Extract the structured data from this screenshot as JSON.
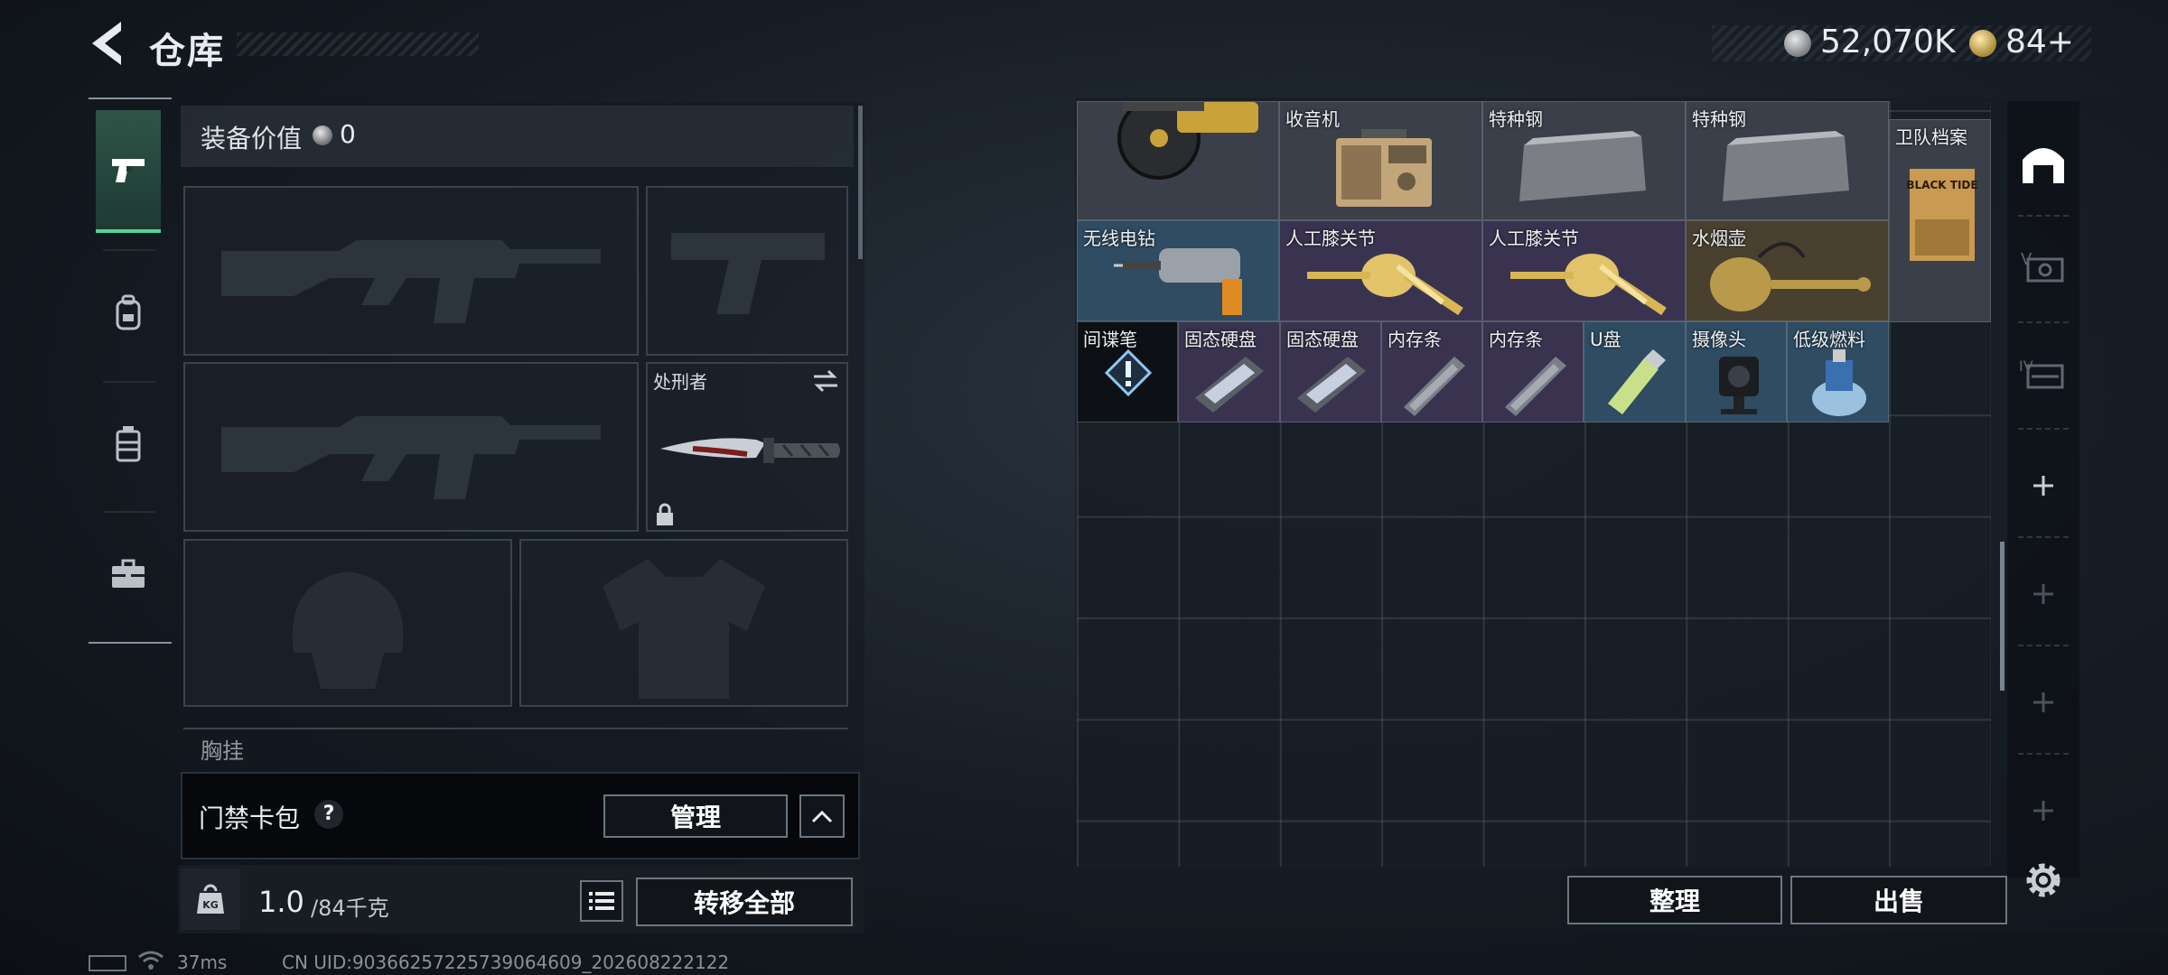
{
  "header": {
    "title": "仓库",
    "silver_currency": "52,070K",
    "gold_currency": "84+"
  },
  "left_tabs": [
    {
      "name": "pistol-icon",
      "active": true
    },
    {
      "name": "backpack-icon",
      "active": false
    },
    {
      "name": "vest-icon",
      "active": false
    },
    {
      "name": "briefcase-icon",
      "active": false
    }
  ],
  "equipment": {
    "value_label": "装备价值",
    "value": "0",
    "melee_slot_name": "处刑者",
    "chest_label": "胸挂",
    "chest_help": "?"
  },
  "card_pack": {
    "label": "门禁卡包",
    "help": "?",
    "manage_label": "管理"
  },
  "weight": {
    "current": "1.0",
    "max": "/84千克",
    "unit_icon_label": "KG",
    "transfer_all_label": "转移全部"
  },
  "status": {
    "ping": "37ms",
    "uid": "CN UID:903662572257390646​09_202608222122"
  },
  "storage_items": [
    {
      "id": "saw",
      "name": ""
    },
    {
      "id": "radio",
      "name": "收音机"
    },
    {
      "id": "steel1",
      "name": "特种钢"
    },
    {
      "id": "steel2",
      "name": "特种钢"
    },
    {
      "id": "guard-file",
      "name": "卫队档案",
      "art_text": "BLACK TIDE"
    },
    {
      "id": "drill",
      "name": "无线电钻"
    },
    {
      "id": "knee1",
      "name": "人工膝关节"
    },
    {
      "id": "knee2",
      "name": "人工膝关节"
    },
    {
      "id": "hookah",
      "name": "水烟壶"
    },
    {
      "id": "spy-pen",
      "name": "间谍笔"
    },
    {
      "id": "ssd1",
      "name": "固态硬盘"
    },
    {
      "id": "ssd2",
      "name": "固态硬盘"
    },
    {
      "id": "ram1",
      "name": "内存条"
    },
    {
      "id": "ram2",
      "name": "内存条"
    },
    {
      "id": "usb",
      "name": "U盘"
    },
    {
      "id": "camera",
      "name": "摄像头"
    },
    {
      "id": "fuel",
      "name": "低级燃料"
    }
  ],
  "storage_actions": {
    "sort_label": "整理",
    "sell_label": "出售"
  },
  "colors": {
    "accent_green": "#4fd39a",
    "rare_blue": "#2f4c63",
    "epic_purple": "#3a3350",
    "legendary_gold": "#4a4030"
  }
}
